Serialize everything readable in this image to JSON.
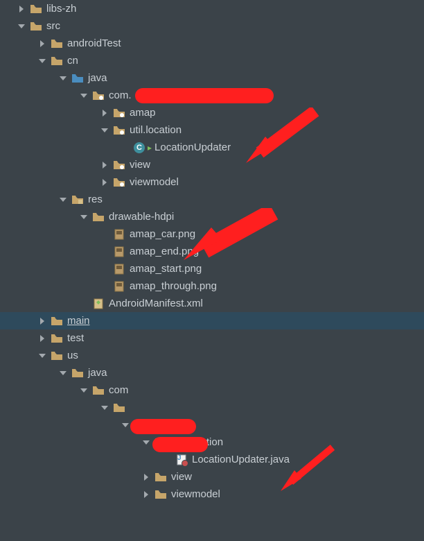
{
  "tree": {
    "n0": {
      "label": "libs-zh",
      "indent": 1,
      "arrow": "right",
      "icon": "folder"
    },
    "n1": {
      "label": "src",
      "indent": 1,
      "arrow": "down",
      "icon": "folder-src"
    },
    "n2": {
      "label": "androidTest",
      "indent": 2,
      "arrow": "right",
      "icon": "folder"
    },
    "n3": {
      "label": "cn",
      "indent": 2,
      "arrow": "down",
      "icon": "folder"
    },
    "n4": {
      "label": "java",
      "indent": 3,
      "arrow": "down",
      "icon": "folder-blue"
    },
    "n5": {
      "label": "com.",
      "indent": 4,
      "arrow": "down",
      "icon": "package"
    },
    "n6": {
      "label": "amap",
      "indent": 5,
      "arrow": "right",
      "icon": "package"
    },
    "n7": {
      "label": "util.location",
      "indent": 5,
      "arrow": "down",
      "icon": "package"
    },
    "n8": {
      "label": "LocationUpdater",
      "indent": 6,
      "arrow": "none",
      "icon": "class"
    },
    "n9": {
      "label": "view",
      "indent": 5,
      "arrow": "right",
      "icon": "package"
    },
    "n10": {
      "label": "viewmodel",
      "indent": 5,
      "arrow": "right",
      "icon": "package"
    },
    "n11": {
      "label": "res",
      "indent": 3,
      "arrow": "down",
      "icon": "folder-res"
    },
    "n12": {
      "label": "drawable-hdpi",
      "indent": 4,
      "arrow": "down",
      "icon": "folder-res"
    },
    "n13": {
      "label": "amap_car.png",
      "indent": 5,
      "arrow": "none",
      "icon": "image"
    },
    "n14": {
      "label": "amap_end.png",
      "indent": 5,
      "arrow": "none",
      "icon": "image"
    },
    "n15": {
      "label": "amap_start.png",
      "indent": 5,
      "arrow": "none",
      "icon": "image"
    },
    "n16": {
      "label": "amap_through.png",
      "indent": 5,
      "arrow": "none",
      "icon": "image"
    },
    "n17": {
      "label": "AndroidManifest.xml",
      "indent": 4,
      "arrow": "none",
      "icon": "manifest"
    },
    "n18": {
      "label": "main",
      "indent": 2,
      "arrow": "right",
      "icon": "folder",
      "selected": true,
      "underline": true
    },
    "n19": {
      "label": "test",
      "indent": 2,
      "arrow": "right",
      "icon": "folder"
    },
    "n20": {
      "label": "us",
      "indent": 2,
      "arrow": "down",
      "icon": "folder"
    },
    "n21": {
      "label": "java",
      "indent": 3,
      "arrow": "down",
      "icon": "folder"
    },
    "n22": {
      "label": "com",
      "indent": 4,
      "arrow": "down",
      "icon": "folder"
    },
    "n23": {
      "label": "",
      "indent": 5,
      "arrow": "down",
      "icon": "folder"
    },
    "n24": {
      "label": "",
      "indent": 6,
      "arrow": "down",
      "icon": "folder"
    },
    "n25": {
      "label": "util.location",
      "indent": 7,
      "arrow": "down",
      "icon": "folder"
    },
    "n26": {
      "label": "LocationUpdater.java",
      "indent": 8,
      "arrow": "none",
      "icon": "java-err"
    },
    "n27": {
      "label": "view",
      "indent": 7,
      "arrow": "right",
      "icon": "folder"
    },
    "n28": {
      "label": "viewmodel",
      "indent": 7,
      "arrow": "right",
      "icon": "folder"
    }
  },
  "colors": {
    "bg": "#3b4349",
    "sel": "#2e4a5c",
    "folder": "#c6a56a",
    "folderBlue": "#4a8dbf",
    "red": "#ff1f1f"
  }
}
